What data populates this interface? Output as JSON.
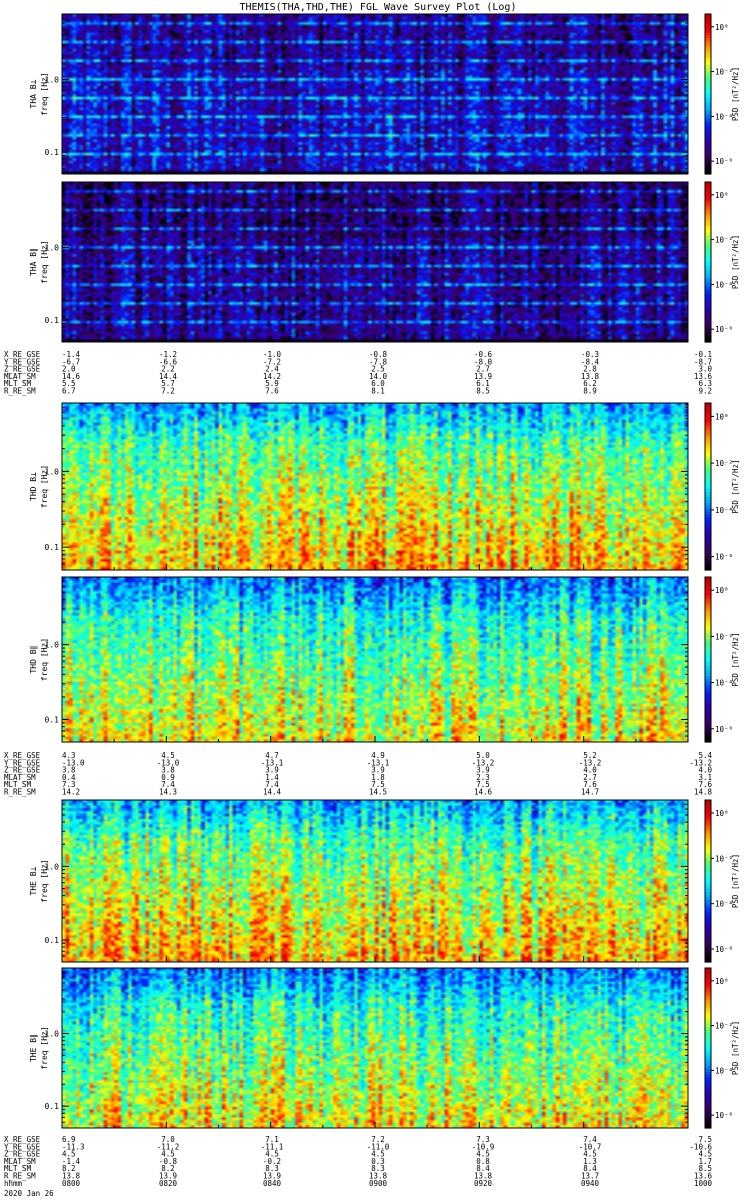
{
  "title": "THEMIS(THA,THD,THE) FGL Wave Survey Plot (Log)",
  "date_label": "2020 Jan 26",
  "colorbar": {
    "label": "PSD [nT²/Hz]",
    "ticks": [
      "10⁰",
      "10⁻²",
      "10⁻⁴",
      "10⁻⁶"
    ],
    "colormap": [
      "#000000",
      "#3a0060",
      "#2a00b0",
      "#0020ff",
      "#00a8ff",
      "#00ffff",
      "#40ff80",
      "#ffff00",
      "#ff9000",
      "#ff0000",
      "#c00000"
    ]
  },
  "chart_data": [
    {
      "type": "heatmap",
      "probe": "THA",
      "panels": [
        {
          "ylabel": "THA B⊥",
          "yunit": "freq [Hz]",
          "ylim": [
            0.05,
            8.0
          ],
          "yscale": "log",
          "ytick_labels": [
            "0.1",
            "1.0"
          ],
          "ytick_values": [
            0.1,
            1.0
          ],
          "level": 0.22
        },
        {
          "ylabel": "THA B∥",
          "yunit": "freq [Hz]",
          "ylim": [
            0.05,
            8.0
          ],
          "yscale": "log",
          "ytick_labels": [
            "0.1",
            "1.0"
          ],
          "ytick_values": [
            0.1,
            1.0
          ],
          "level": 0.17
        }
      ],
      "ephemeris": [
        {
          "label": "X_RE_GSE",
          "values": [
            "-1.4",
            "-1.2",
            "-1.0",
            "-0.8",
            "-0.6",
            "-0.3",
            "-0.1"
          ]
        },
        {
          "label": "Y_RE_GSE",
          "values": [
            "-6.7",
            "-6.6",
            "-7.2",
            "-7.8",
            "-8.0",
            "-8.4",
            "-8.7"
          ]
        },
        {
          "label": "Z_RE_GSE",
          "values": [
            "2.0",
            "2.2",
            "2.4",
            "2.5",
            "2.7",
            "2.8",
            "3.0"
          ]
        },
        {
          "label": "MLAT_SM",
          "values": [
            "14.6",
            "14.4",
            "14.2",
            "14.0",
            "13.9",
            "13.8",
            "13.6"
          ]
        },
        {
          "label": "MLT_SM",
          "values": [
            "5.5",
            "5.7",
            "5.9",
            "6.0",
            "6.1",
            "6.2",
            "6.3"
          ]
        },
        {
          "label": "R_RE_SM",
          "values": [
            "6.7",
            "7.2",
            "7.6",
            "8.1",
            "8.5",
            "8.9",
            "9.2"
          ]
        }
      ]
    },
    {
      "type": "heatmap",
      "probe": "THD",
      "panels": [
        {
          "ylabel": "THD B⊥",
          "yunit": "freq [Hz]",
          "ylim": [
            0.05,
            8.0
          ],
          "yscale": "log",
          "ytick_labels": [
            "0.1",
            "1.0"
          ],
          "ytick_values": [
            0.1,
            1.0
          ],
          "level": 0.6
        },
        {
          "ylabel": "THD B∥",
          "yunit": "freq [Hz]",
          "ylim": [
            0.05,
            8.0
          ],
          "yscale": "log",
          "ytick_labels": [
            "0.1",
            "1.0"
          ],
          "ytick_values": [
            0.1,
            1.0
          ],
          "level": 0.55
        }
      ],
      "ephemeris": [
        {
          "label": "X_RE_GSE",
          "values": [
            "4.3",
            "4.5",
            "4.7",
            "4.9",
            "5.0",
            "5.2",
            "5.4"
          ]
        },
        {
          "label": "Y_RE_GSE",
          "values": [
            "-13.0",
            "-13.0",
            "-13.1",
            "-13.1",
            "-13.2",
            "-13.2",
            "-13.2"
          ]
        },
        {
          "label": "Z_RE_GSE",
          "values": [
            "3.8",
            "3.8",
            "3.9",
            "3.9",
            "3.9",
            "4.0",
            "4.0"
          ]
        },
        {
          "label": "MLAT_SM",
          "values": [
            "0.4",
            "0.9",
            "1.4",
            "1.8",
            "2.3",
            "2.7",
            "3.1"
          ]
        },
        {
          "label": "MLT_SM",
          "values": [
            "7.3",
            "7.4",
            "7.4",
            "7.5",
            "7.5",
            "7.6",
            "7.6"
          ]
        },
        {
          "label": "R_RE_SM",
          "values": [
            "14.2",
            "14.3",
            "14.4",
            "14.5",
            "14.6",
            "14.7",
            "14.8"
          ]
        }
      ]
    },
    {
      "type": "heatmap",
      "probe": "THE",
      "panels": [
        {
          "ylabel": "THE B⊥",
          "yunit": "freq [Hz]",
          "ylim": [
            0.05,
            8.0
          ],
          "yscale": "log",
          "ytick_labels": [
            "0.1",
            "1.0"
          ],
          "ytick_values": [
            0.1,
            1.0
          ],
          "level": 0.6
        },
        {
          "ylabel": "THE B∥",
          "yunit": "freq [Hz]",
          "ylim": [
            0.05,
            8.0
          ],
          "yscale": "log",
          "ytick_labels": [
            "0.1",
            "1.0"
          ],
          "ytick_values": [
            0.1,
            1.0
          ],
          "level": 0.55
        }
      ],
      "ephemeris": [
        {
          "label": "X_RE_GSE",
          "values": [
            "6.9",
            "7.0",
            "7.1",
            "7.2",
            "7.3",
            "7.4",
            "7.5"
          ]
        },
        {
          "label": "Y_RE_GSE",
          "values": [
            "-11.3",
            "-11.2",
            "-11.1",
            "-11.0",
            "-10.9",
            "-10.7",
            "-10.6"
          ]
        },
        {
          "label": "Z_RE_GSE",
          "values": [
            "4.5",
            "4.5",
            "4.5",
            "4.5",
            "4.5",
            "4.5",
            "4.5"
          ]
        },
        {
          "label": "MLAT_SM",
          "values": [
            "-1.4",
            "-0.8",
            "-0.2",
            "0.3",
            "0.8",
            "1.3",
            "1.7"
          ]
        },
        {
          "label": "MLT_SM",
          "values": [
            "8.2",
            "8.2",
            "8.3",
            "8.3",
            "8.4",
            "8.4",
            "8.5"
          ]
        },
        {
          "label": "R_RE_SM",
          "values": [
            "13.8",
            "13.9",
            "13.9",
            "13.8",
            "13.8",
            "13.7",
            "13.6"
          ]
        },
        {
          "label": "hhmm",
          "values": [
            "0800",
            "0820",
            "0840",
            "0900",
            "0920",
            "0940",
            "1000"
          ]
        }
      ]
    }
  ]
}
